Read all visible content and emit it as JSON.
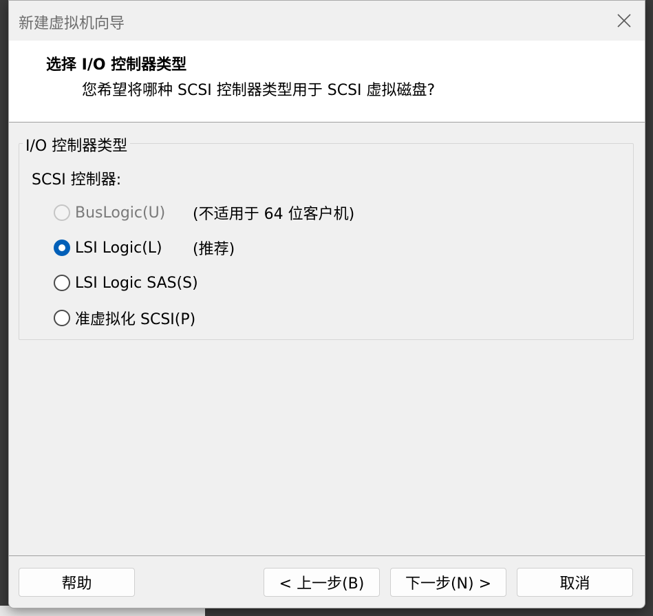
{
  "window": {
    "title": "新建虚拟机向导"
  },
  "header": {
    "title": "选择 I/O 控制器类型",
    "subtitle": "您希望将哪种 SCSI 控制器类型用于 SCSI 虚拟磁盘?"
  },
  "group": {
    "legend": "I/O 控制器类型",
    "field_label": "SCSI 控制器:",
    "options": [
      {
        "label": "BusLogic(U)",
        "note": "(不适用于 64 位客户机)",
        "state": "disabled"
      },
      {
        "label": "LSI Logic(L)",
        "note": "(推荐)",
        "state": "checked"
      },
      {
        "label": "LSI Logic SAS(S)",
        "note": "",
        "state": "unchecked"
      },
      {
        "label": "准虚拟化 SCSI(P)",
        "note": "",
        "state": "unchecked"
      }
    ]
  },
  "footer": {
    "help": "帮助",
    "back": "< 上一步(B)",
    "next": "下一步(N) >",
    "cancel": "取消"
  },
  "colors": {
    "accent": "#005fb8",
    "dialog_bg": "#f0f0f0",
    "header_bg": "#ffffff"
  },
  "icons": {
    "close": "close-icon"
  }
}
